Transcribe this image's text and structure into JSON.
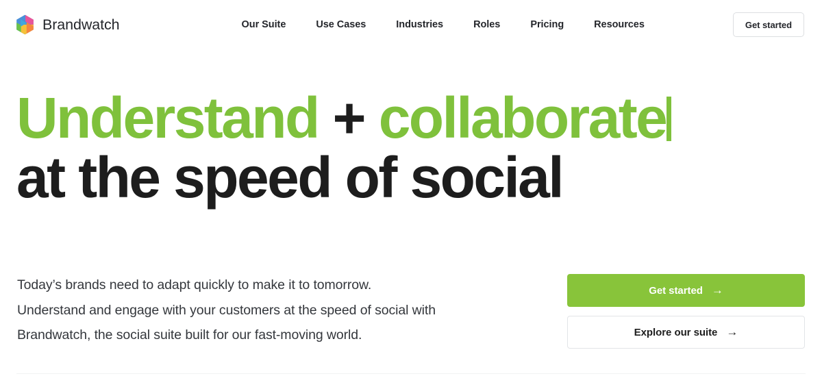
{
  "header": {
    "brand": {
      "name": "Brandwatch",
      "logo_icon": "brandwatch-hexagon-logo",
      "logo_colors": {
        "pink": "#F0648C",
        "magenta": "#E8559B",
        "blue": "#4A90D9",
        "cyan": "#3FA9DE",
        "green": "#6CC24A",
        "yellow": "#F5C13A",
        "orange": "#F5863F"
      }
    },
    "nav_items": [
      {
        "label": "Our Suite"
      },
      {
        "label": "Use Cases"
      },
      {
        "label": "Industries"
      },
      {
        "label": "Roles"
      },
      {
        "label": "Pricing"
      },
      {
        "label": "Resources"
      }
    ],
    "cta_label": "Get started"
  },
  "hero": {
    "headline_line1_accent": "Understand",
    "headline_line1_plus": "+",
    "headline_line1_accent2": "collaborate",
    "headline_line2": "at the speed of social",
    "accent_color": "#7FC13C",
    "text_color": "#1D1D1D",
    "caret_visible": true,
    "paragraph_lines": [
      "Today’s brands need to adapt quickly to make it to tomorrow.",
      "Understand and engage with your customers at the speed of social with",
      "Brandwatch, the social suite built for our fast-moving world."
    ],
    "buttons": [
      {
        "label": "Get started",
        "arrow_icon": "arrow-right-icon",
        "arrow": "→",
        "style": "primary",
        "background": "#88C43A"
      },
      {
        "label": "Explore our suite",
        "arrow_icon": "arrow-right-icon",
        "arrow": "→",
        "style": "secondary",
        "background": "#FFFFFF"
      }
    ]
  }
}
